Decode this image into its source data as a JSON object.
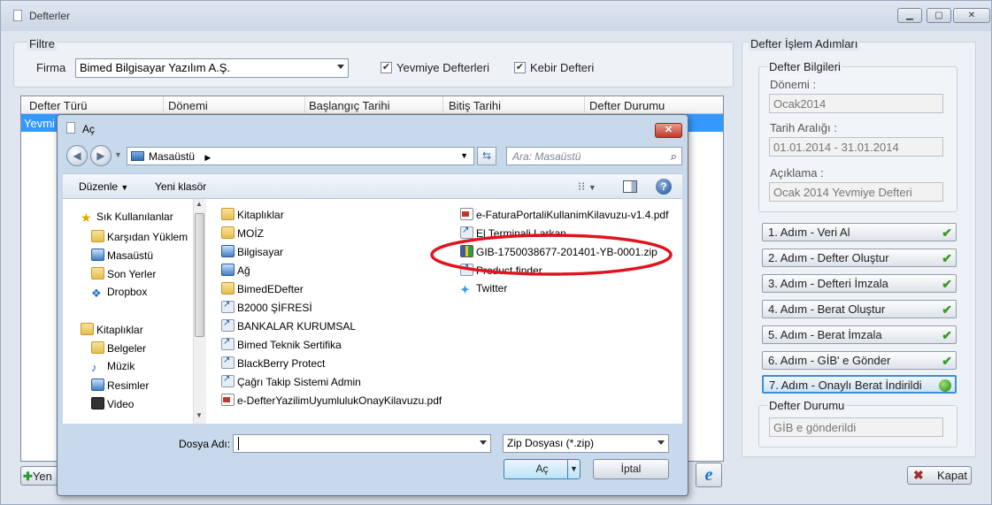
{
  "window": {
    "title": "Defterler"
  },
  "filter": {
    "group_label": "Filtre",
    "firma_label": "Firma",
    "firma_value": "Bimed Bilgisayar Yazılım A.Ş.",
    "yevmiye_label": "Yevmiye Defterleri",
    "kebir_label": "Kebir Defteri"
  },
  "grid": {
    "columns": [
      "Defter Türü",
      "Dönemi",
      "Başlangıç Tarihi",
      "Bitiş Tarihi",
      "Defter Durumu"
    ],
    "selected_row_text": "Yevmi",
    "selection_color": "#3399ff"
  },
  "bottom_left_button": "Yen",
  "right": {
    "group_label": "Defter İşlem Adımları",
    "info_label": "Defter Bilgileri",
    "donemi_label": "Dönemi :",
    "donemi_value": "Ocak2014",
    "tarih_label": "Tarih Aralığı :",
    "tarih_value": "01.01.2014 - 31.01.2014",
    "aciklama_label": "Açıklama :",
    "aciklama_value": "Ocak 2014 Yevmiye Defteri",
    "steps": [
      "1. Adım - Veri Al",
      "2. Adım - Defter Oluştur",
      "3. Adım - Defteri İmzala",
      "4. Adım - Berat Oluştur",
      "5. Adım - Berat İmzala",
      "6. Adım - GİB' e Gönder",
      "7. Adım - Onaylı Berat İndirildi"
    ],
    "durum_label": "Defter Durumu",
    "durum_value": "GİB e gönderildi",
    "close_button": "Kapat"
  },
  "dialog": {
    "title": "Aç",
    "address": "Masaüstü",
    "search_placeholder": "Ara: Masaüstü",
    "toolbar": {
      "organize": "Düzenle",
      "new_folder": "Yeni klasör"
    },
    "favorites_header": "Sık Kullanılanlar",
    "favorites": [
      "Karşıdan Yüklem",
      "Masaüstü",
      "Son Yerler",
      "Dropbox"
    ],
    "libraries_header": "Kitaplıklar",
    "libraries": [
      "Belgeler",
      "Müzik",
      "Resimler",
      "Video"
    ],
    "files_col1": [
      {
        "name": "Kitaplıklar",
        "icon": "library-icon"
      },
      {
        "name": "MOİZ",
        "icon": "folder-icon"
      },
      {
        "name": "Bilgisayar",
        "icon": "computer-icon"
      },
      {
        "name": "Ağ",
        "icon": "network-icon"
      },
      {
        "name": "BimedEDefter",
        "icon": "folder-icon"
      },
      {
        "name": "B2000 ŞİFRESİ",
        "icon": "shortcut-icon"
      },
      {
        "name": "BANKALAR KURUMSAL",
        "icon": "shortcut-icon"
      },
      {
        "name": "Bimed Teknik Sertifika",
        "icon": "shortcut-icon"
      },
      {
        "name": "BlackBerry Protect",
        "icon": "shortcut-icon"
      },
      {
        "name": "Çağrı Takip Sistemi Admin",
        "icon": "shortcut-icon"
      },
      {
        "name": "e-DefterYazilimUyumlulukOnayKilavuzu.pdf",
        "icon": "pdf-icon"
      }
    ],
    "files_col2": [
      {
        "name": "e-FaturaPortaliKullanimKilavuzu-v1.4.pdf",
        "icon": "pdf-icon"
      },
      {
        "name": "El Terminali Larkan",
        "icon": "shortcut-icon"
      },
      {
        "name": "GIB-1750038677-201401-YB-0001.zip",
        "icon": "zip-icon"
      },
      {
        "name": "Product finder",
        "icon": "shortcut-icon"
      },
      {
        "name": "Twitter",
        "icon": "twitter-icon"
      }
    ],
    "filename_label": "Dosya Adı:",
    "filename_value": "",
    "filetype_value": "Zip Dosyası (*.zip)",
    "open_button": "Aç",
    "cancel_button": "İptal",
    "highlight_color": "#e0141e"
  }
}
